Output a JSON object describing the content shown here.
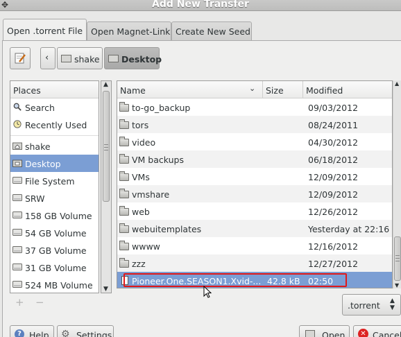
{
  "window": {
    "title": "Add New Transfer"
  },
  "tabs": [
    {
      "label": "Open .torrent File",
      "active": true
    },
    {
      "label": "Open Magnet-Link",
      "active": false
    },
    {
      "label": "Create New Seed",
      "active": false
    }
  ],
  "breadcrumb": {
    "items": [
      "shake",
      "Desktop"
    ],
    "active": "Desktop"
  },
  "places": {
    "header": "Places",
    "items": [
      {
        "label": "Search",
        "icon": "search-icon"
      },
      {
        "label": "Recently Used",
        "icon": "clock-icon"
      },
      {
        "label": "shake",
        "icon": "home-folder-icon"
      },
      {
        "label": "Desktop",
        "icon": "desktop-folder-icon",
        "selected": true
      },
      {
        "label": "File System",
        "icon": "drive-icon"
      },
      {
        "label": "SRW",
        "icon": "drive-icon"
      },
      {
        "label": "158 GB Volume",
        "icon": "drive-icon"
      },
      {
        "label": "54 GB Volume",
        "icon": "drive-icon"
      },
      {
        "label": "37 GB Volume",
        "icon": "drive-icon"
      },
      {
        "label": "31 GB Volume",
        "icon": "drive-icon"
      },
      {
        "label": "524 MB Volume",
        "icon": "drive-icon"
      }
    ]
  },
  "files": {
    "columns": {
      "name": "Name",
      "size": "Size",
      "modified": "Modified"
    },
    "rows": [
      {
        "name": "to-go_backup",
        "size": "",
        "modified": "09/03/2012"
      },
      {
        "name": "tors",
        "size": "",
        "modified": "08/24/2011"
      },
      {
        "name": "video",
        "size": "",
        "modified": "04/30/2012"
      },
      {
        "name": "VM backups",
        "size": "",
        "modified": "06/18/2012"
      },
      {
        "name": "VMs",
        "size": "",
        "modified": "12/09/2012"
      },
      {
        "name": "vmshare",
        "size": "",
        "modified": "12/09/2012"
      },
      {
        "name": "web",
        "size": "",
        "modified": "12/26/2012"
      },
      {
        "name": "webuitemplates",
        "size": "",
        "modified": "Yesterday at 22:16"
      },
      {
        "name": "wwww",
        "size": "",
        "modified": "12/16/2012"
      },
      {
        "name": "zzz",
        "size": "",
        "modified": "12/27/2012"
      }
    ],
    "selected": {
      "name": "Pioneer.One.SEASON1.Xvid-...",
      "size": "42.8 kB",
      "modified": "02:50"
    }
  },
  "filter": {
    "value": ".torrent"
  },
  "buttons": {
    "help": "Help",
    "settings": "Settings",
    "open": "Open",
    "cancel": "Cancel",
    "add": "+",
    "remove": "−"
  },
  "colors": {
    "selection": "#7b9ed4",
    "highlight": "#e01818"
  }
}
